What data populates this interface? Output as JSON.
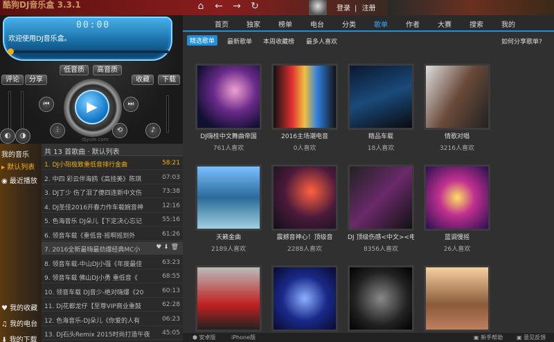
{
  "titlebar": {
    "title": "酷狗DJ音乐盒 3.3.1",
    "login": "登录",
    "register": "注册"
  },
  "player": {
    "time": "00:00",
    "welcome": "欢迎使用DJ音乐盒。",
    "progress": 0.0,
    "quality_low": "低音质",
    "quality_high": "高音质",
    "comment": "评论",
    "share": "分享",
    "collect": "收藏",
    "download": "下载",
    "url": "djyule.com"
  },
  "leftnav": {
    "items": [
      {
        "label": "我的音乐"
      },
      {
        "label": "默认列表"
      },
      {
        "label": "最近播放"
      },
      {
        "label": "我的收藏"
      },
      {
        "label": "我的电台"
      },
      {
        "label": "我的下载"
      }
    ]
  },
  "playlist": {
    "header": "共 13 首歌曲 · 默认列表",
    "songs": [
      {
        "title": "1. DJ小阳极致重低音排行金曲",
        "dur": "58:21",
        "state": "playing"
      },
      {
        "title": "2. 中四 彩云伴海鸥《高挂美》陈琪",
        "dur": "07:03"
      },
      {
        "title": "3. DJ丁少 伤了泪了傻四连新中文伤",
        "dur": "73:38"
      },
      {
        "title": "4. DJ圣佳2016开春力作车载婉音神",
        "dur": "12:16"
      },
      {
        "title": "5. 色海音乐 DJ朵儿【下定决心忘记",
        "dur": "55:16"
      },
      {
        "title": "6. 领音车载《重低音·摇啊摇到外",
        "dur": "61:26"
      },
      {
        "title": "7. 2016全新最嗨最劲爆经典MC小",
        "dur": "",
        "state": "hover"
      },
      {
        "title": "8. 领音车载-中山DJ小强《年度最佳",
        "dur": "63:23"
      },
      {
        "title": "9. 领音车载 佛山DJ小勇 重低音《",
        "dur": "68:55"
      },
      {
        "title": "10. 领音车载 DJ音少-绝对嗨爆《20",
        "dur": "60:13"
      },
      {
        "title": "11. Dj花都龙仔【至尊VIP商业重鼓",
        "dur": "62:28"
      },
      {
        "title": "12. 色海音乐-DJ朵儿《你爱的人有",
        "dur": "06:23"
      },
      {
        "title": "13. DJ石头Remix 2015时尚打造午夜",
        "dur": "45:05"
      }
    ]
  },
  "topnav": {
    "items": [
      "首页",
      "独家",
      "榜单",
      "电台",
      "分类",
      "歌单",
      "作者",
      "大赛",
      "搜索",
      "我的"
    ],
    "active": "歌单"
  },
  "subtabs": {
    "items": [
      "精选歌单",
      "最新歌单",
      "本周收藏榜",
      "最多人喜欢"
    ],
    "active": "精选歌单",
    "help": "如何分享歌单?"
  },
  "cards": [
    {
      "name": "DJ嗨桂中文舞曲帝国",
      "likes": "761人喜欢"
    },
    {
      "name": "2016主场潮电音",
      "likes": "0人喜欢"
    },
    {
      "name": "精品车载",
      "likes": "18人喜欢"
    },
    {
      "name": "情歌对唱",
      "likes": "3216人喜欢"
    },
    {
      "name": "天籁金曲",
      "likes": "2189人喜欢"
    },
    {
      "name": "震撼音神心！顶级音",
      "likes": "2288人喜欢"
    },
    {
      "name": "DJ 顶级伤感<中文><电",
      "likes": "8356人喜欢"
    },
    {
      "name": "蓝调慢摇",
      "likes": "26人喜欢"
    },
    {
      "name": "",
      "likes": ""
    },
    {
      "name": "",
      "likes": ""
    },
    {
      "name": "",
      "likes": ""
    },
    {
      "name": "",
      "likes": ""
    }
  ],
  "bottombar": {
    "android": "安卓版",
    "iphone": "iPhone版",
    "help": "新手帮助",
    "feedback": "意见反馈"
  },
  "colors": {
    "accent": "#1e8fd8",
    "playing": "#f5b010"
  }
}
